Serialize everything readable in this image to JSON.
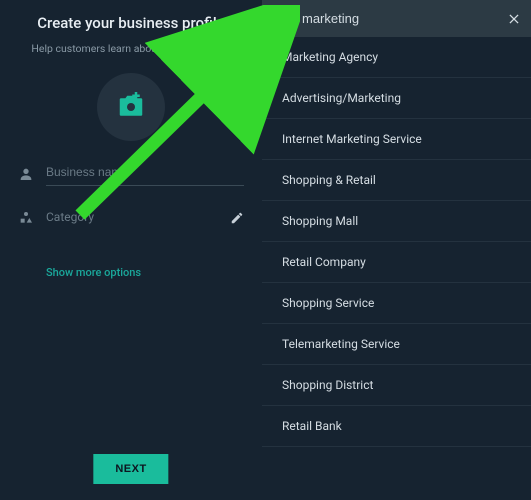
{
  "left": {
    "title": "Create your business profile",
    "subtitle": "Help customers learn about your business.",
    "businessName": {
      "placeholder": "Business name",
      "value": ""
    },
    "category": {
      "label": "Category"
    },
    "showMore": "Show more options",
    "nextButton": "NEXT"
  },
  "right": {
    "search": {
      "value": "marketing"
    },
    "results": [
      "Marketing Agency",
      "Advertising/Marketing",
      "Internet Marketing Service",
      "Shopping & Retail",
      "Shopping Mall",
      "Retail Company",
      "Shopping Service",
      "Telemarketing Service",
      "Shopping District",
      "Retail Bank"
    ]
  },
  "annotation": {
    "arrowColor": "#34d82d"
  }
}
